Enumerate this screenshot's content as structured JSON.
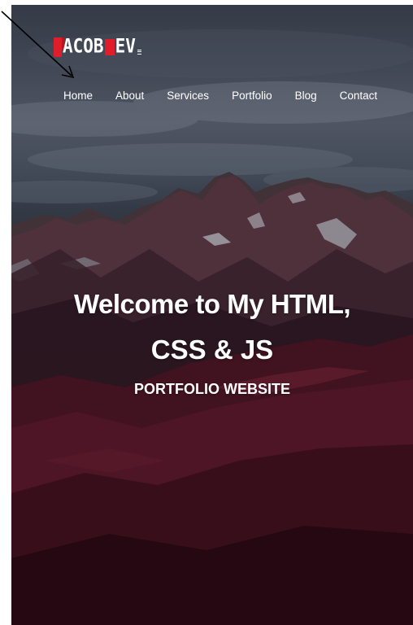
{
  "logo": {
    "text_left": "ACOB",
    "text_right": "EV",
    "accent_color": "#e01e2a"
  },
  "nav": {
    "items": [
      {
        "label": "Home"
      },
      {
        "label": "About"
      },
      {
        "label": "Services"
      },
      {
        "label": "Portfolio"
      },
      {
        "label": "Blog"
      },
      {
        "label": "Contact"
      }
    ]
  },
  "hero": {
    "headline_line1": "Welcome to My HTML,",
    "headline_line2": "CSS & JS",
    "subtitle": "PORTFOLIO WEBSITE",
    "background": "mountain-landscape-photo"
  },
  "colors": {
    "accent": "#e01e2a",
    "text": "#ffffff",
    "annotation": "#000000"
  }
}
